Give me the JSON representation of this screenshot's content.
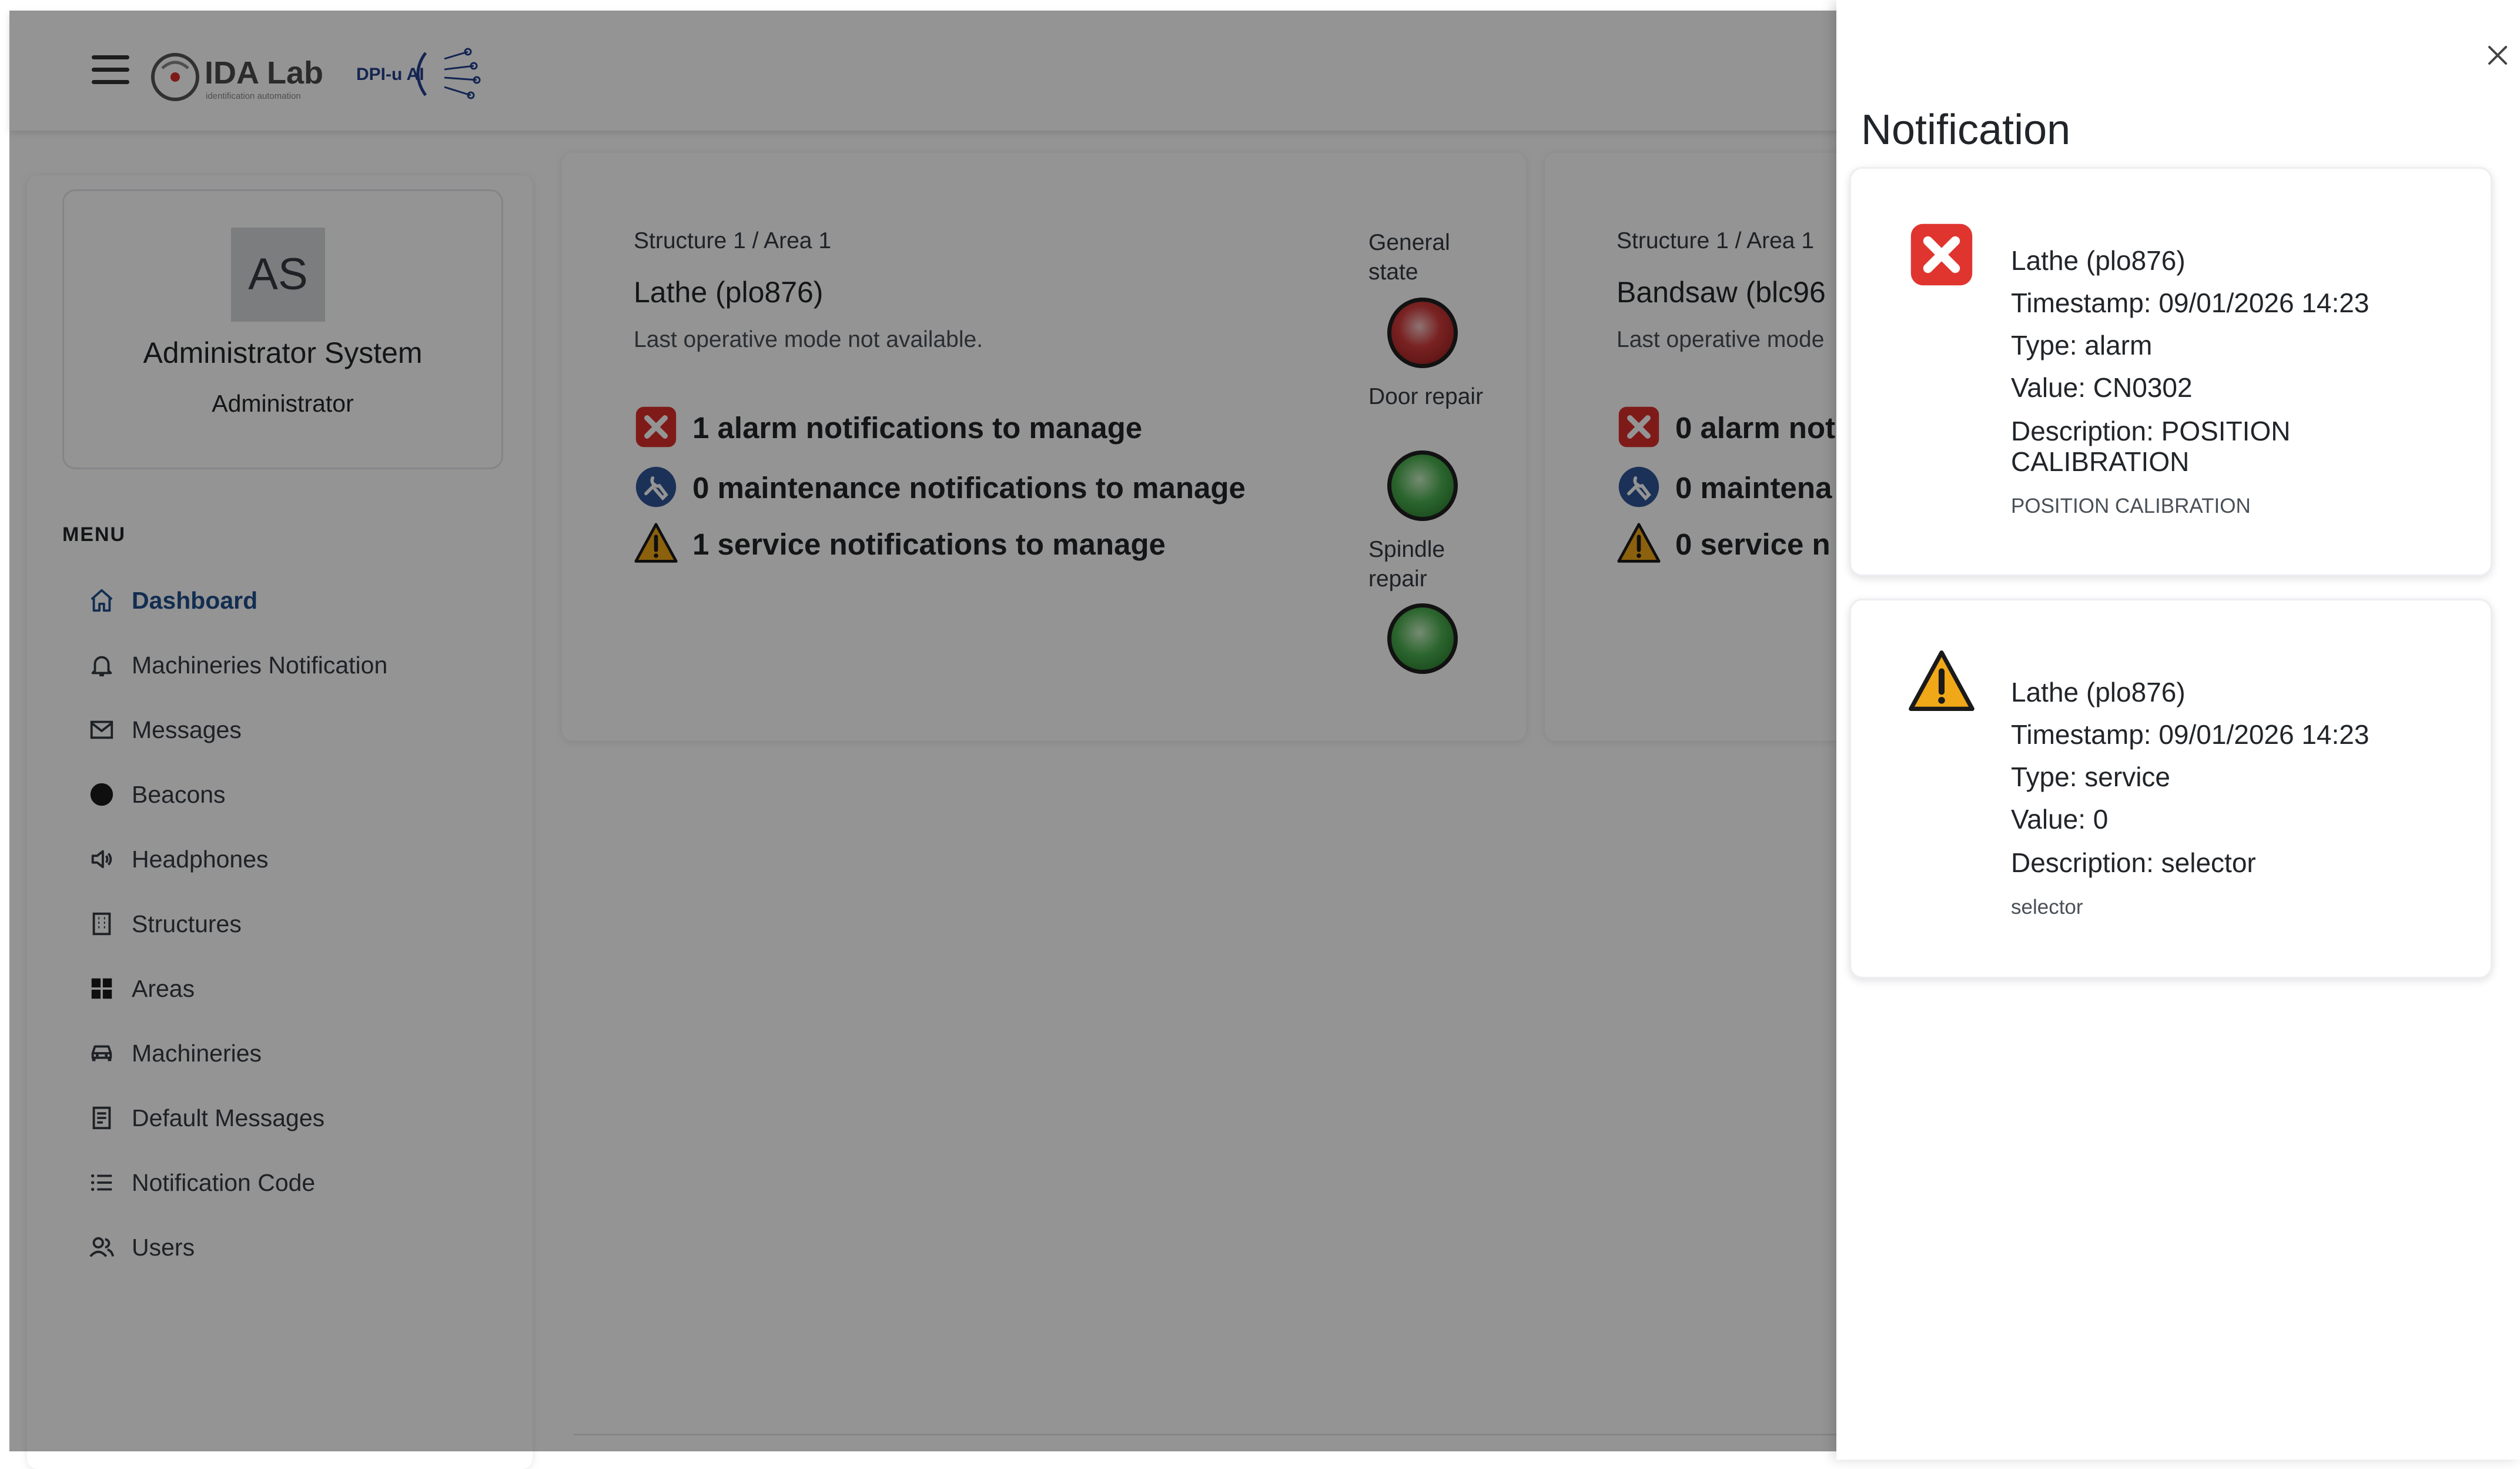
{
  "header": {
    "logo_text": "IDA Lab",
    "logo_subtext": "identification automation",
    "logo2_text": "DPI-u AI"
  },
  "profile": {
    "initials": "AS",
    "name": "Administrator System",
    "role": "Administrator"
  },
  "menu": {
    "title": "MENU",
    "items": [
      {
        "label": "Dashboard",
        "icon": "home-icon",
        "active": true
      },
      {
        "label": "Machineries Notification",
        "icon": "bell-icon"
      },
      {
        "label": "Messages",
        "icon": "envelope-icon"
      },
      {
        "label": "Beacons",
        "icon": "circle-icon"
      },
      {
        "label": "Headphones",
        "icon": "speaker-icon"
      },
      {
        "label": "Structures",
        "icon": "building-icon"
      },
      {
        "label": "Areas",
        "icon": "grid-icon"
      },
      {
        "label": "Machineries",
        "icon": "car-icon"
      },
      {
        "label": "Default Messages",
        "icon": "document-icon"
      },
      {
        "label": "Notification Code",
        "icon": "list-icon"
      },
      {
        "label": "Users",
        "icon": "users-icon"
      }
    ]
  },
  "cards": [
    {
      "breadcrumb": "Structure 1 / Area 1",
      "machine": "Lathe (plo876)",
      "mode": "Last operative mode not available.",
      "alarm_text": "1 alarm notifications to manage",
      "maintenance_text": "0 maintenance notifications to manage",
      "service_text": "1 service notifications to manage",
      "states": [
        {
          "label": "General state",
          "status": "red"
        },
        {
          "label": "Door repair",
          "status": "green"
        },
        {
          "label": "Spindle repair",
          "status": "green"
        }
      ]
    },
    {
      "breadcrumb": "Structure 1 / Area 1",
      "machine": "Bandsaw (blc96",
      "mode": "Last operative mode",
      "alarm_text": "0 alarm not",
      "maintenance_text": "0 maintena",
      "service_text": "0 service n"
    }
  ],
  "panel": {
    "title": "Notification",
    "notifications": [
      {
        "icon": "error-icon",
        "title": "Lathe (plo876)",
        "timestamp": "Timestamp: 09/01/2026 14:23",
        "type": "Type: alarm",
        "value": "Value: CN0302",
        "description": "Description: POSITION CALIBRATION",
        "detail": "POSITION CALIBRATION"
      },
      {
        "icon": "warning-icon",
        "title": "Lathe (plo876)",
        "timestamp": "Timestamp: 09/01/2026 14:23",
        "type": "Type: service",
        "value": "Value: 0",
        "description": "Description: selector",
        "detail": "selector"
      }
    ]
  },
  "colors": {
    "accent": "#1f4e8c",
    "alarm": "#d9302c",
    "warning": "#f0a818",
    "maintenance": "#2f5597"
  }
}
